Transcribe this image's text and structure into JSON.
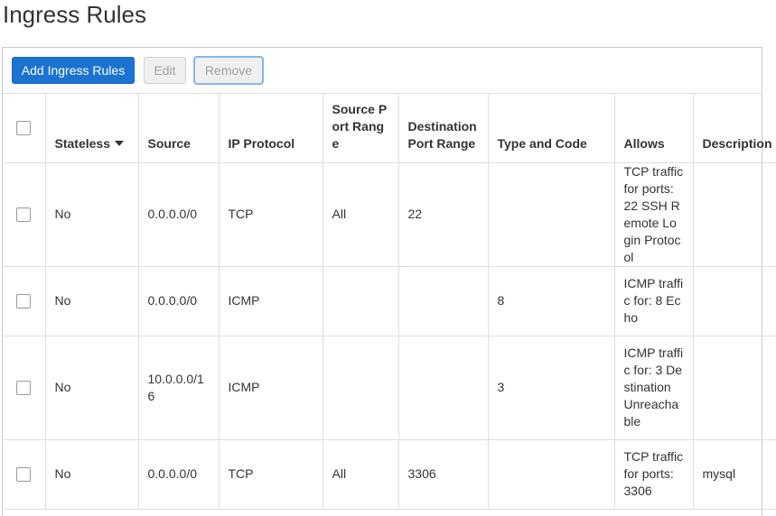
{
  "page": {
    "title": "Ingress Rules"
  },
  "toolbar": {
    "add_label": "Add Ingress Rules",
    "edit_label": "Edit",
    "remove_label": "Remove"
  },
  "table": {
    "headers": {
      "stateless": "Stateless",
      "source": "Source",
      "ip_protocol": "IP Protocol",
      "source_port_range": "Source Port Range",
      "destination_port_range": "Destination Port Range",
      "type_and_code": "Type and Code",
      "allows": "Allows",
      "description": "Description"
    },
    "rows": [
      {
        "stateless": "No",
        "source": "0.0.0.0/0",
        "ip_protocol": "TCP",
        "source_port_range": "All",
        "destination_port_range": "22",
        "type_and_code": "",
        "allows": "TCP traffic for ports: 22 SSH Remote Login Protocol",
        "description": ""
      },
      {
        "stateless": "No",
        "source": "0.0.0.0/0",
        "ip_protocol": "ICMP",
        "source_port_range": "",
        "destination_port_range": "",
        "type_and_code": "8",
        "allows": "ICMP traffic for: 8 Echo",
        "description": ""
      },
      {
        "stateless": "No",
        "source": "10.0.0.0/16",
        "ip_protocol": "ICMP",
        "source_port_range": "",
        "destination_port_range": "",
        "type_and_code": "3",
        "allows": "ICMP traffic for: 3 Destination Unreachable",
        "description": ""
      },
      {
        "stateless": "No",
        "source": "0.0.0.0/0",
        "ip_protocol": "TCP",
        "source_port_range": "All",
        "destination_port_range": "3306",
        "type_and_code": "",
        "allows": "TCP traffic for ports: 3306",
        "description": "mysql"
      }
    ]
  },
  "colors": {
    "primary": "#1a73d1",
    "border": "#dddddd",
    "text": "#333333"
  }
}
